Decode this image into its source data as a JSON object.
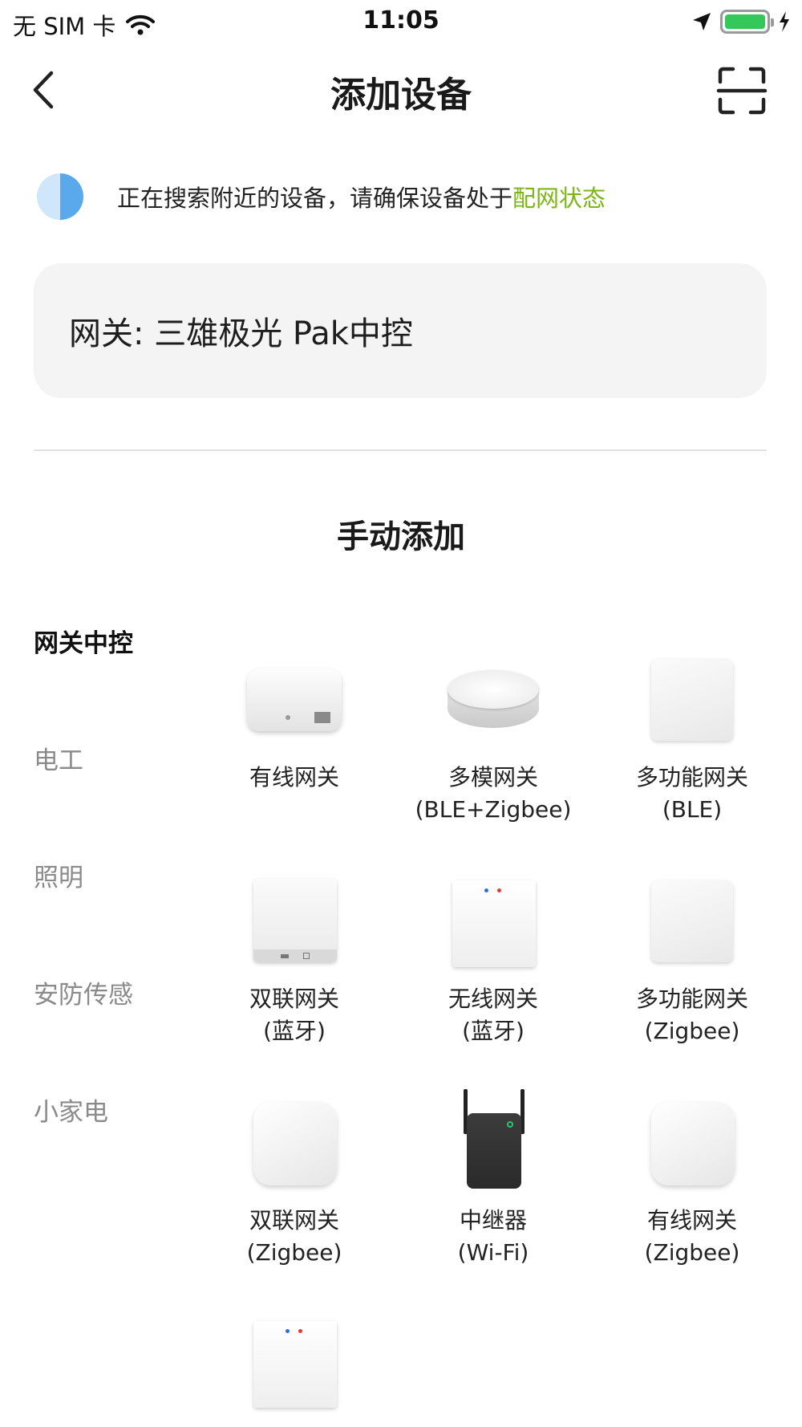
{
  "status_bar": {
    "carrier": "无 SIM 卡",
    "time": "11:05",
    "battery_color": "#34c759"
  },
  "nav": {
    "title": "添加设备",
    "back_icon": "chevron-left-icon",
    "scan_icon": "scan-icon"
  },
  "search": {
    "text": "正在搜索附近的设备，请确保设备处于",
    "link": "配网状态",
    "link_color": "#7cb518"
  },
  "gateway_card": {
    "text": "网关: 三雄极光 Pak中控"
  },
  "section_title": "手动添加",
  "categories": [
    "网关中控",
    "电工",
    "照明",
    "安防传感",
    "小家电"
  ],
  "active_category": "网关中控",
  "devices": [
    {
      "name": "有线网关",
      "sub": ""
    },
    {
      "name": "多模网关",
      "sub": "(BLE+Zigbee)"
    },
    {
      "name": "多功能网关",
      "sub": "(BLE)"
    },
    {
      "name": "双联网关",
      "sub": "(蓝牙)"
    },
    {
      "name": "无线网关",
      "sub": "(蓝牙)"
    },
    {
      "name": "多功能网关",
      "sub": "(Zigbee)"
    },
    {
      "name": "双联网关",
      "sub": "(Zigbee)"
    },
    {
      "name": "中继器",
      "sub": "(Wi-Fi)"
    },
    {
      "name": "有线网关",
      "sub": "(Zigbee)"
    },
    {
      "name": "",
      "sub": ""
    }
  ]
}
